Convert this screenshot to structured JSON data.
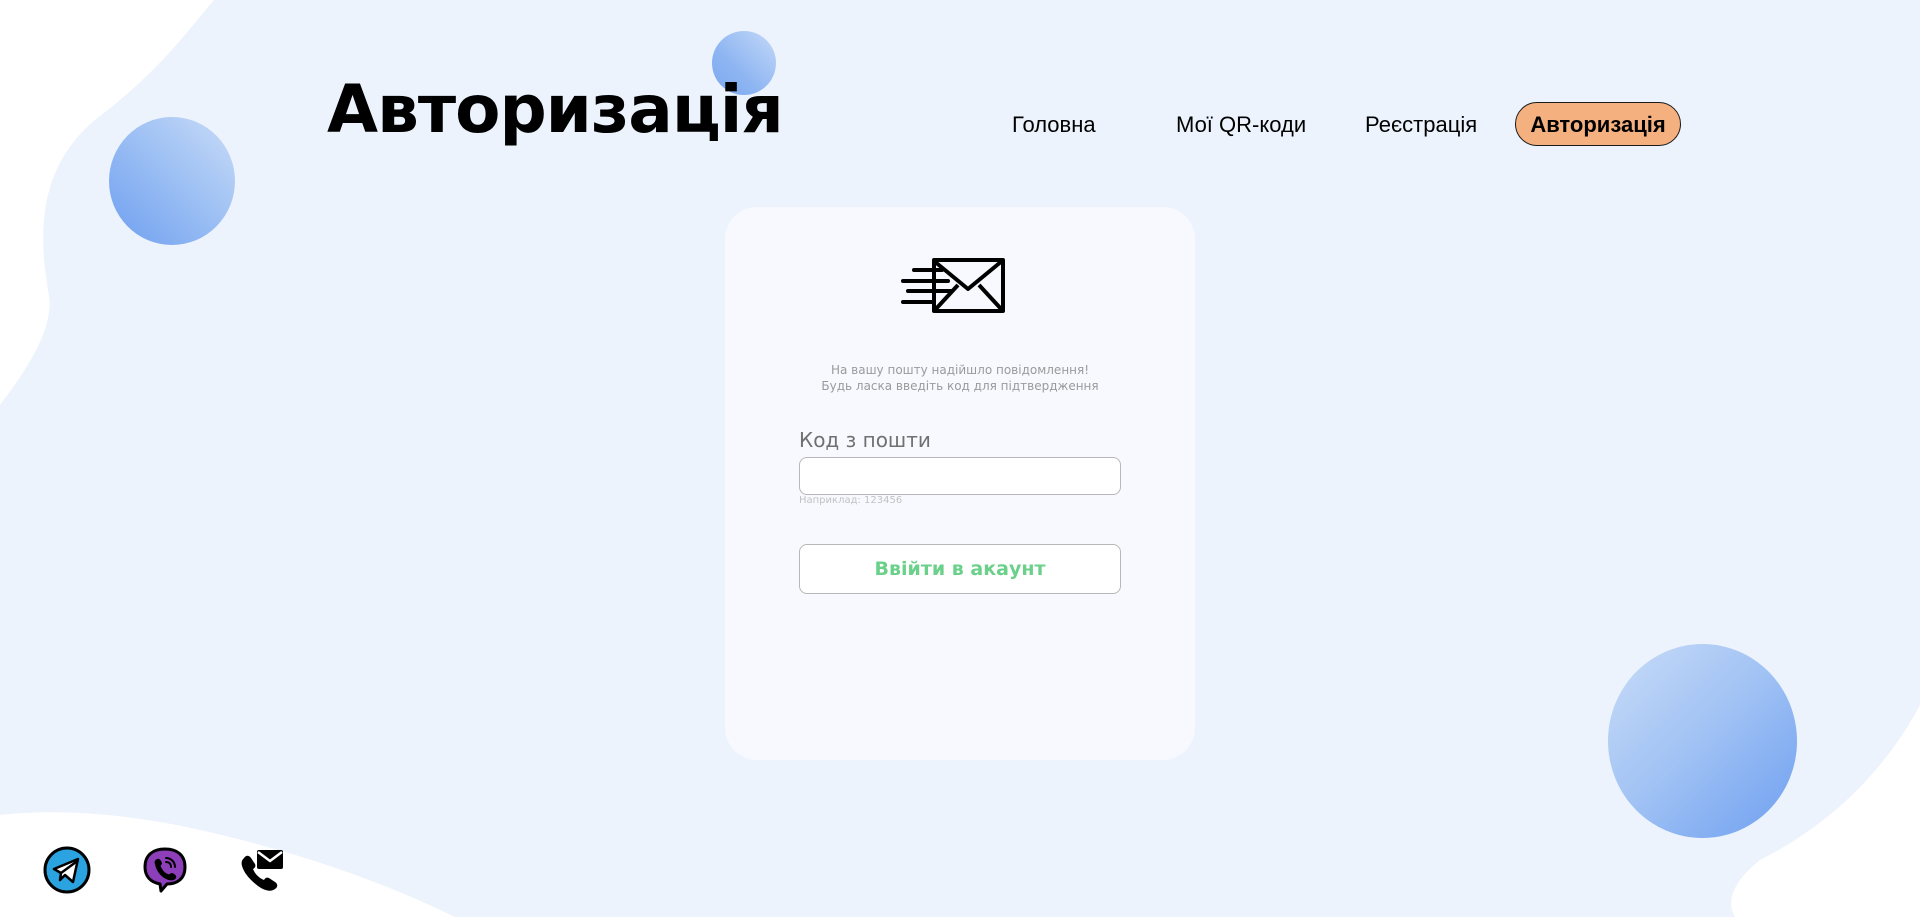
{
  "colors": {
    "background": "#ecf3fc",
    "card": "#f7f9fe",
    "accent_orange": "#f4b07e",
    "button_text_green": "#6ad08a",
    "telegram_blue": "#2aa3e0",
    "viber_purple": "#8c3fb8"
  },
  "header": {
    "title": "Авторизація"
  },
  "nav": {
    "items": [
      {
        "label": "Головна"
      },
      {
        "label": "Мої QR-коди"
      },
      {
        "label": "Реєстрація"
      },
      {
        "label": "Авторизація",
        "active": true
      }
    ]
  },
  "card": {
    "icon": "envelope-fast-icon",
    "message_line1": "На вашу пошту надійшло повідомлення!",
    "message_line2": "Будь ласка введіть код для підтвердження",
    "code_label": "Код з пошти",
    "code_value": "",
    "code_hint": "Наприклад: 123456",
    "submit_label": "Ввійти в акаунт"
  },
  "footer": {
    "social": [
      {
        "icon": "telegram-icon"
      },
      {
        "icon": "viber-icon"
      },
      {
        "icon": "phone-mail-icon"
      }
    ]
  }
}
